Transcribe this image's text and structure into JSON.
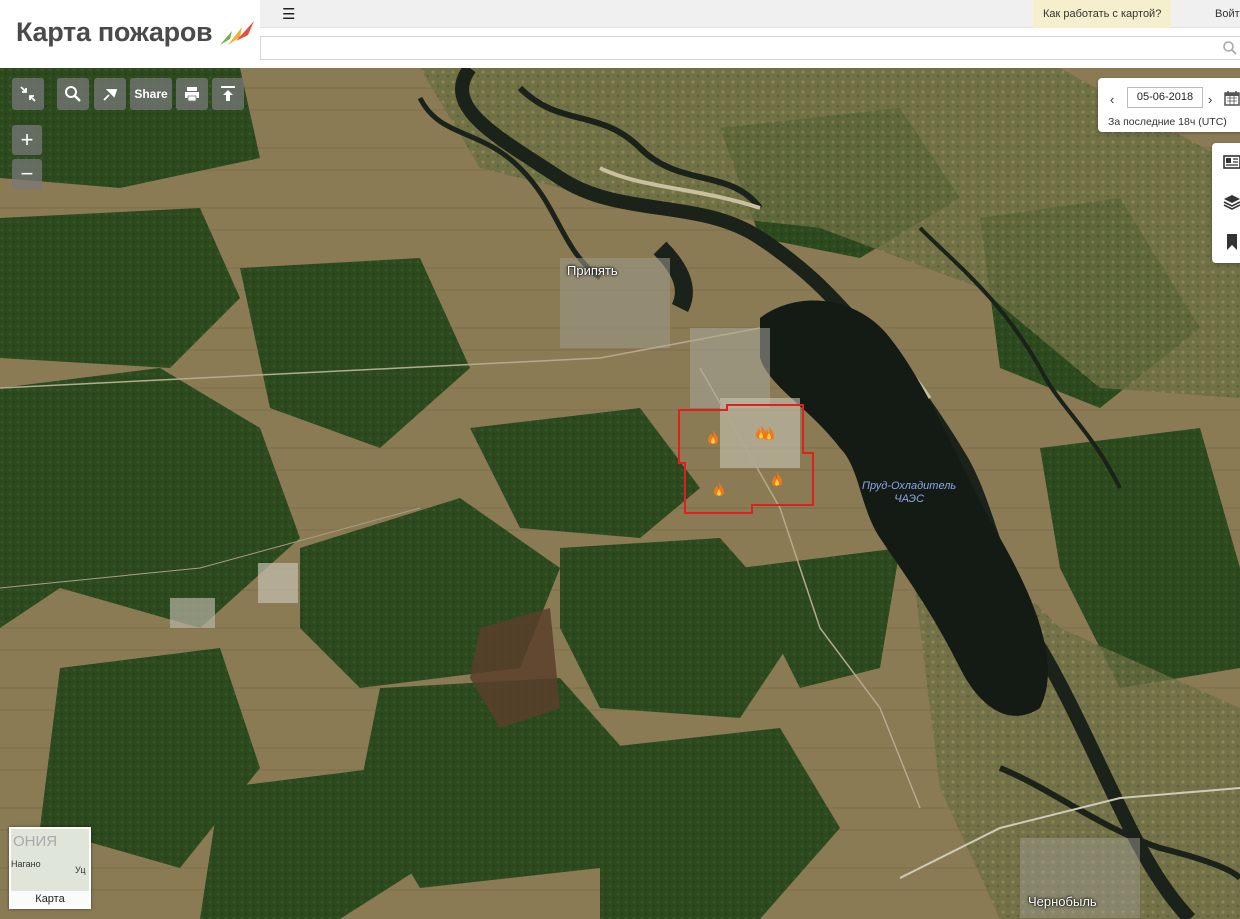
{
  "app": {
    "title": "Карта пожаров"
  },
  "topbar": {
    "help_label": "Как работать с картой?",
    "login_label": "Войт"
  },
  "search": {
    "value": "",
    "placeholder": ""
  },
  "toolbar": {
    "share_label": "Share",
    "zoom_in_label": "+",
    "zoom_out_label": "−"
  },
  "date_panel": {
    "date_value": "05-06-2018",
    "period_label": "За последние 18ч (UTC)"
  },
  "map_labels": {
    "pripyat": "Припять",
    "lake_line1": "Пруд-Охладитель",
    "lake_line2": "ЧАЭС",
    "chernobyl": "Чернобыль"
  },
  "minimap": {
    "region_text": "ОНИЯ",
    "city1": "Нагано",
    "city2": "Уц",
    "label": "Карта"
  },
  "fires": {
    "count_visible": 5
  },
  "colors": {
    "fire_outline": "#e0201c",
    "help_bg": "#f6efcd",
    "lake": "#141a14",
    "river": "#1a221a",
    "forest": "#2c4a1c",
    "field": "#8a7a52"
  },
  "icons": [
    "fullscreen-collapse-icon",
    "search-icon",
    "pin-icon",
    "print-icon",
    "upload-icon",
    "calendar-icon",
    "news-icon",
    "layers-icon",
    "bookmark-icon",
    "flame-icon",
    "hamburger-icon"
  ]
}
